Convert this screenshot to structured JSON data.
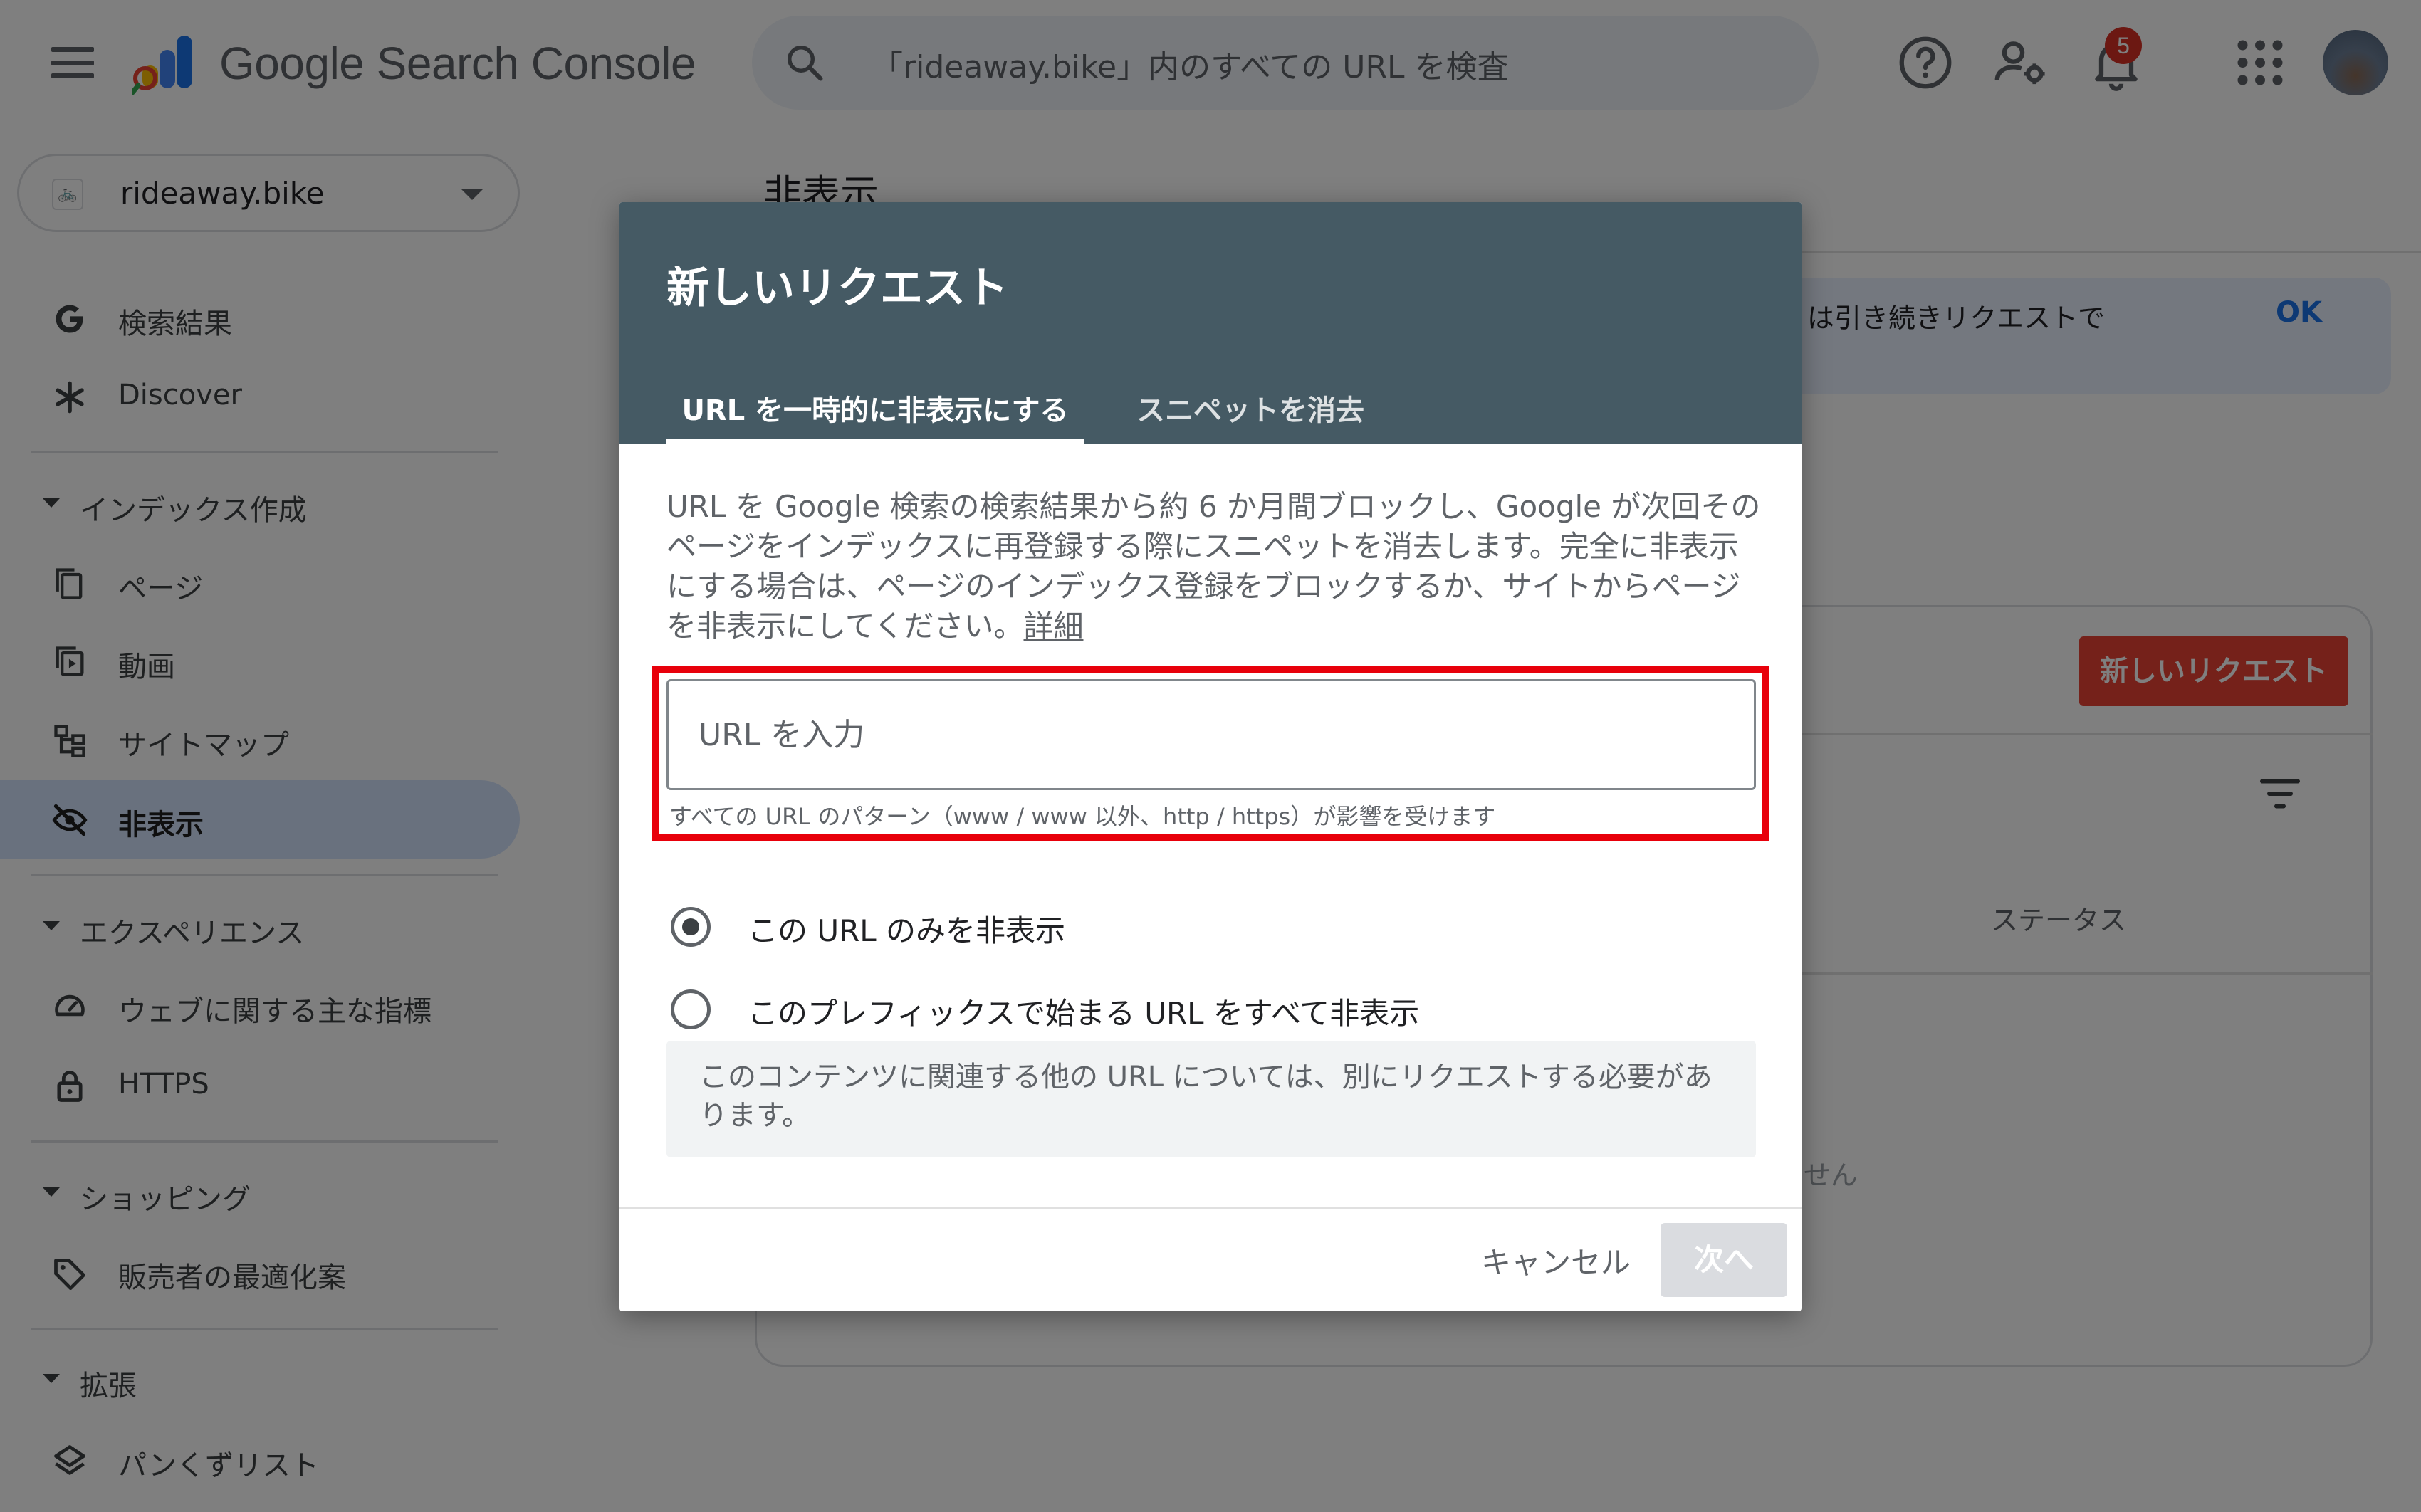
{
  "topbar": {
    "product_name": "Google Search Console",
    "search_placeholder": "「rideaway.bike」内のすべての URL を検査",
    "notification_count": "5",
    "icons": [
      "menu-icon",
      "search-icon",
      "help-icon",
      "manage-users-icon",
      "notifications-icon",
      "apps-icon"
    ]
  },
  "sidebar": {
    "property": "rideaway.bike",
    "items": [
      {
        "label": "検索結果",
        "icon": "google-g-icon"
      },
      {
        "label": "Discover",
        "icon": "asterisk-icon"
      },
      {
        "label": "インデックス作成",
        "section": true
      },
      {
        "label": "ページ",
        "icon": "pages-icon"
      },
      {
        "label": "動画",
        "icon": "video-icon"
      },
      {
        "label": "サイトマップ",
        "icon": "sitemap-icon"
      },
      {
        "label": "非表示",
        "icon": "eye-off-icon",
        "active": true
      },
      {
        "label": "エクスペリエンス",
        "section": true
      },
      {
        "label": "ウェブに関する主な指標",
        "icon": "gauge-icon"
      },
      {
        "label": "HTTPS",
        "icon": "lock-icon"
      },
      {
        "label": "ショッピング",
        "section": true
      },
      {
        "label": "販売者の最適化案",
        "icon": "tag-icon"
      },
      {
        "label": "拡張",
        "section": true
      },
      {
        "label": "パンくずリスト",
        "icon": "layers-icon"
      }
    ]
  },
  "main": {
    "page_title": "非表示",
    "banner_text": "は引き続きリクエストで",
    "banner_ok": "OK",
    "new_request_button": "新しいリクエスト",
    "status_header": "ステータス",
    "empty_text": "ません"
  },
  "dialog": {
    "title": "新しいリクエスト",
    "tabs": [
      {
        "label": "URL を一時的に非表示にする",
        "active": true
      },
      {
        "label": "スニペットを消去",
        "active": false
      }
    ],
    "description": "URL を Google 検索の検索結果から約 6 か月間ブロックし、Google が次回そのページをインデックスに再登録する際にスニペットを消去します。完全に非表示にする場合は、ページのインデックス登録をブロックするか、サイトからページを非表示にしてください。",
    "details_link": "詳細",
    "url_input": {
      "placeholder": "URL を入力",
      "value": ""
    },
    "input_hint": "すべての URL のパターン（www / www 以外、http / https）が影響を受けます",
    "options": [
      {
        "label": "この URL のみを非表示",
        "checked": true
      },
      {
        "label": "このプレフィックスで始まる URL をすべて非表示",
        "checked": false
      }
    ],
    "info": "このコンテンツに関連する他の URL については、別にリクエストする必要があります。",
    "cancel_label": "キャンセル",
    "next_label": "次へ"
  },
  "colors": {
    "dialog_header": "#455a64",
    "highlight": "#e8000b",
    "primary_action": "#ea4335",
    "active_nav": "#d3e3fd",
    "link": "#1a73e8"
  }
}
